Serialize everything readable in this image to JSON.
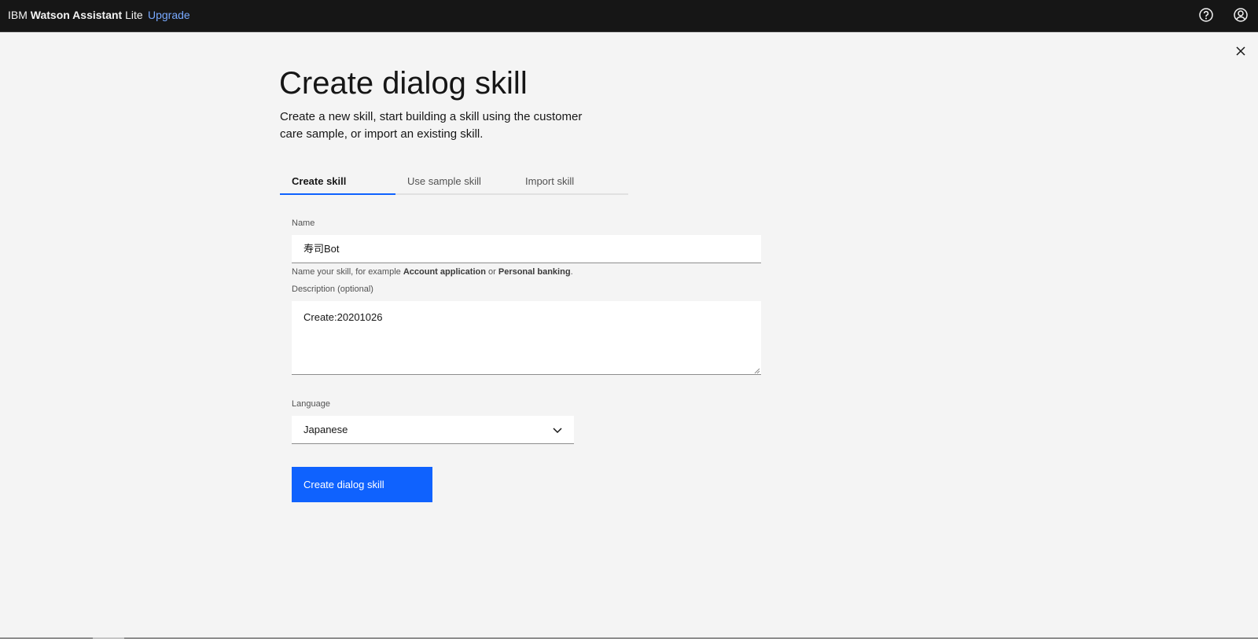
{
  "header": {
    "brand_prefix": "IBM ",
    "brand_bold": "Watson Assistant",
    "brand_suffix": " Lite",
    "upgrade_label": "Upgrade",
    "icons": [
      "help-icon",
      "user-avatar-icon"
    ]
  },
  "page": {
    "title": "Create dialog skill",
    "subtitle": "Create a new skill, start building a skill using the customer care sample, or import an existing skill."
  },
  "tabs": [
    {
      "label": "Create skill",
      "active": true
    },
    {
      "label": "Use sample skill",
      "active": false
    },
    {
      "label": "Import skill",
      "active": false
    }
  ],
  "form": {
    "name_label": "Name",
    "name_value": "寿司Bot",
    "name_helper_prefix": "Name your skill, for example ",
    "name_helper_example1": "Account application",
    "name_helper_mid": " or ",
    "name_helper_example2": "Personal banking",
    "name_helper_suffix": ".",
    "description_label": "Description (optional)",
    "description_value": "Create:20201026",
    "language_label": "Language",
    "language_value": "Japanese",
    "submit_label": "Create dialog skill"
  },
  "colors": {
    "topbar": "#161616",
    "accent": "#0f62fe",
    "upgrade_link": "#78a9ff",
    "background": "#f4f4f4"
  }
}
